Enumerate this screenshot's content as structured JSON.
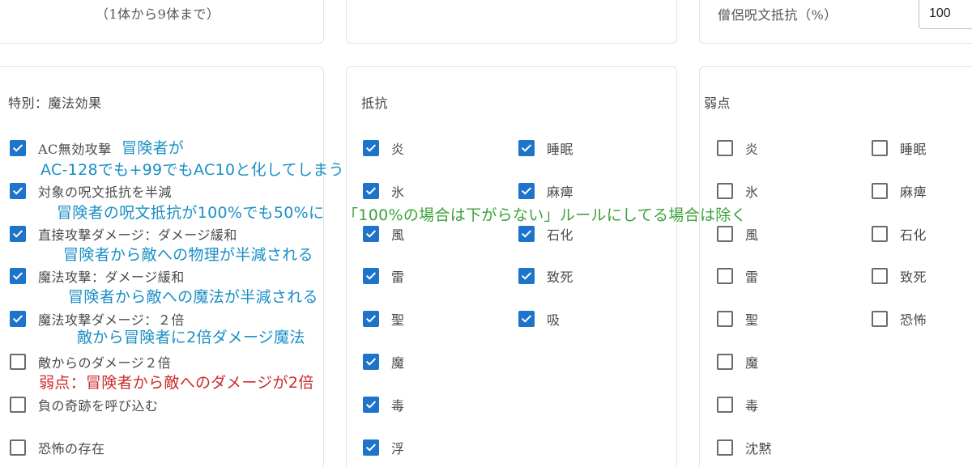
{
  "top": {
    "hint": "（1体から9体まで）",
    "priest_label": "僧侶呪文抵抗（%）",
    "priest_value": "100"
  },
  "special": {
    "title": "特別：魔法効果",
    "items": [
      {
        "label": "AC無効攻撃",
        "checked": true
      },
      {
        "label": "対象の呪文抵抗を半減",
        "checked": true
      },
      {
        "label": "直接攻撃ダメージ：ダメージ緩和",
        "checked": true
      },
      {
        "label": "魔法攻撃：ダメージ緩和",
        "checked": true
      },
      {
        "label": "魔法攻撃ダメージ：２倍",
        "checked": true
      },
      {
        "label": "敵からのダメージ２倍",
        "checked": false
      },
      {
        "label": "負の奇跡を呼び込む",
        "checked": false
      },
      {
        "label": "恐怖の存在",
        "checked": false
      }
    ]
  },
  "resist": {
    "title": "抵抗",
    "col1": [
      {
        "label": "炎",
        "checked": true
      },
      {
        "label": "氷",
        "checked": true
      },
      {
        "label": "風",
        "checked": true
      },
      {
        "label": "雷",
        "checked": true
      },
      {
        "label": "聖",
        "checked": true
      },
      {
        "label": "魔",
        "checked": true
      },
      {
        "label": "毒",
        "checked": true
      },
      {
        "label": "浮",
        "checked": true
      }
    ],
    "col2": [
      {
        "label": "睡眠",
        "checked": true
      },
      {
        "label": "麻痺",
        "checked": true
      },
      {
        "label": "石化",
        "checked": true
      },
      {
        "label": "致死",
        "checked": true
      },
      {
        "label": "吸",
        "checked": true
      }
    ]
  },
  "weak": {
    "title": "弱点",
    "col1": [
      {
        "label": "炎",
        "checked": false
      },
      {
        "label": "氷",
        "checked": false
      },
      {
        "label": "風",
        "checked": false
      },
      {
        "label": "雷",
        "checked": false
      },
      {
        "label": "聖",
        "checked": false
      },
      {
        "label": "魔",
        "checked": false
      },
      {
        "label": "毒",
        "checked": false
      },
      {
        "label": "沈黙",
        "checked": false
      }
    ],
    "col2": [
      {
        "label": "睡眠",
        "checked": false
      },
      {
        "label": "麻痺",
        "checked": false
      },
      {
        "label": "石化",
        "checked": false
      },
      {
        "label": "致死",
        "checked": false
      },
      {
        "label": "恐怖",
        "checked": false
      }
    ]
  },
  "notes": {
    "n1": "冒険者が",
    "n2": "AC-128でも+99でもAC10と化してしまう",
    "n3": "冒険者の呪文抵抗が100%でも50%に",
    "n4": "「100%の場合は下がらない」ルールにしてる場合は除く",
    "n5": "冒険者から敵への物理が半減される",
    "n6": "冒険者から敵への魔法が半減される",
    "n7": "敵から冒険者に2倍ダメージ魔法",
    "n8": "弱点：冒険者から敵へのダメージが2倍"
  },
  "colors": {
    "checkbox_checked": "#1e74c9",
    "note_blue": "#1a8fc6",
    "note_green": "#3aa23a",
    "note_red": "#cc2a2a"
  }
}
